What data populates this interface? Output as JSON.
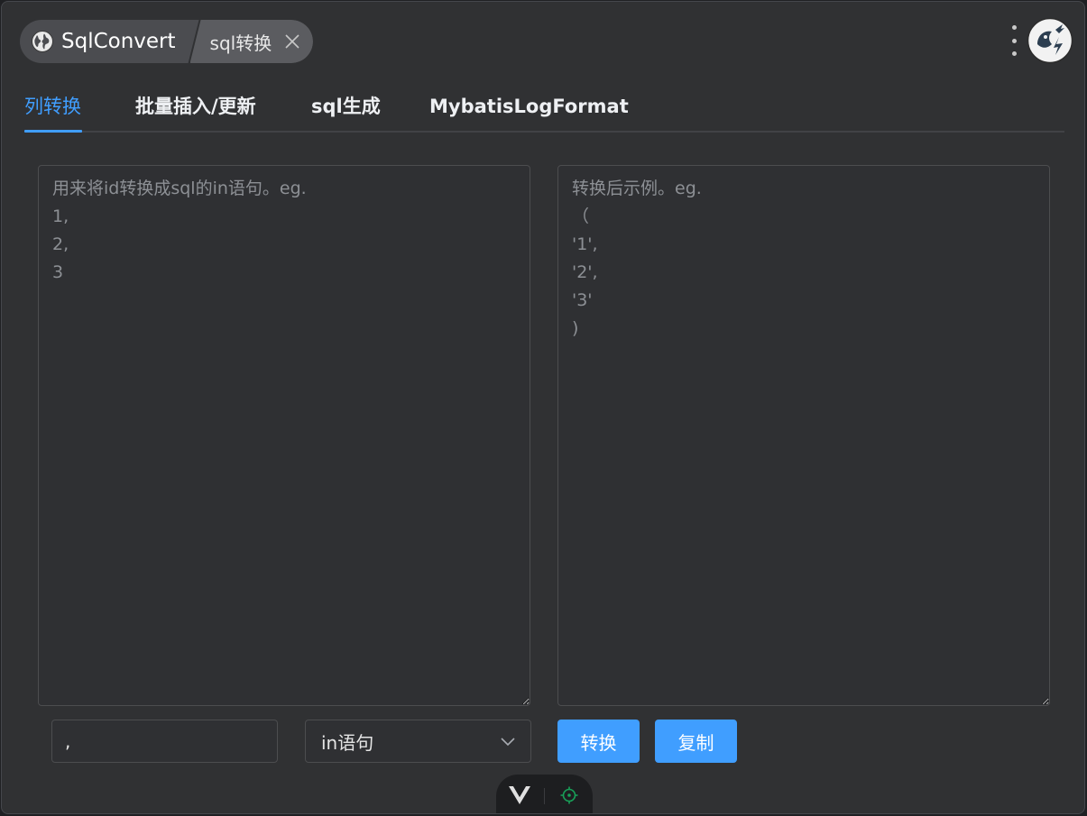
{
  "header": {
    "app_name": "SqlConvert",
    "current_feature": "sql转换"
  },
  "tabs": [
    {
      "label": "列转换",
      "active": true
    },
    {
      "label": "批量插入/更新",
      "active": false
    },
    {
      "label": "sql生成",
      "active": false
    },
    {
      "label": "MybatisLogFormat",
      "active": false
    }
  ],
  "input_area": {
    "placeholder": "用来将id转换成sql的in语句。eg.\n1,\n2,\n3"
  },
  "output_area": {
    "placeholder": "转换后示例。eg.\n（\n'1',\n'2',\n'3'\n)"
  },
  "controls": {
    "separator_value": ",",
    "mode_select_value": "in语句",
    "convert_label": "转换",
    "copy_label": "复制"
  },
  "colors": {
    "accent": "#409eff",
    "panel_bg": "#303133",
    "border": "#4c4d4f"
  },
  "icons": [
    "globe-icon",
    "close-icon",
    "more-vertical-icon",
    "app-logo-icon",
    "chevron-down-icon",
    "vue-logo-icon",
    "target-icon"
  ]
}
